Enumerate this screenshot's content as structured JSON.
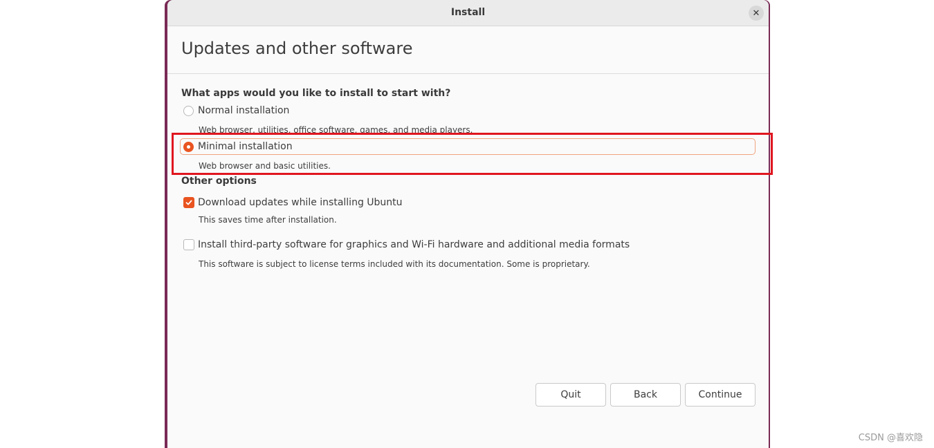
{
  "window": {
    "title": "Install",
    "close_glyph": "✕",
    "close_icon": "close-icon"
  },
  "page": {
    "heading": "Updates and other software"
  },
  "install_type": {
    "question": "What apps would you like to install to start with?",
    "options": [
      {
        "label": "Normal installation",
        "description": "Web browser, utilities, office software, games, and media players.",
        "selected": false
      },
      {
        "label": "Minimal installation",
        "description": "Web browser and basic utilities.",
        "selected": true
      }
    ]
  },
  "other_options": {
    "title": "Other options",
    "items": [
      {
        "label": "Download updates while installing Ubuntu",
        "description": "This saves time after installation.",
        "checked": true
      },
      {
        "label": "Install third-party software for graphics and Wi-Fi hardware and additional media formats",
        "description": "This software is subject to license terms included with its documentation. Some is proprietary.",
        "checked": false
      }
    ]
  },
  "buttons": {
    "quit": "Quit",
    "back": "Back",
    "continue": "Continue"
  },
  "watermark": "CSDN @喜欢隐",
  "colors": {
    "accent": "#e95420",
    "annotation": "#e0161f",
    "desktop": "#7a2a55"
  }
}
